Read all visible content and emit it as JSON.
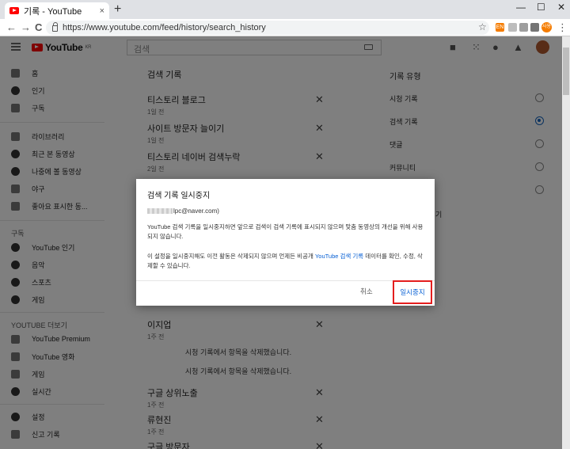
{
  "browser": {
    "tab_title": "기록 - YouTube",
    "tab_close": "×",
    "new_tab": "+",
    "url": "https://www.youtube.com/feed/history/search_history",
    "window_controls": [
      "—",
      "☐",
      "✕"
    ],
    "nav": {
      "back": "←",
      "forward": "→",
      "reload": "C"
    },
    "extensions": [
      {
        "label": "EN",
        "color": "#f57c00"
      },
      {
        "label": "",
        "color": "#bdbdbd"
      },
      {
        "label": "",
        "color": "#9e9e9e"
      },
      {
        "label": "",
        "color": "#757575"
      }
    ],
    "profile_label": "사용"
  },
  "header": {
    "logo_text": "YouTube",
    "logo_region": "KR",
    "search_placeholder": "검색",
    "icons": [
      "video-create-icon",
      "apps-icon",
      "messages-icon",
      "notifications-icon"
    ]
  },
  "sidebar": {
    "items_top": [
      {
        "label": "홈",
        "icon": "home-icon"
      },
      {
        "label": "인기",
        "icon": "trending-icon"
      },
      {
        "label": "구독",
        "icon": "subscriptions-icon"
      }
    ],
    "items_library": [
      {
        "label": "라이브러리",
        "icon": "library-icon"
      },
      {
        "label": "최근 본 동영상",
        "icon": "history-icon"
      },
      {
        "label": "나중에 볼 동영상",
        "icon": "watch-later-icon"
      },
      {
        "label": "야구",
        "icon": "playlist-icon"
      },
      {
        "label": "좋아요 표시한 동...",
        "icon": "like-icon"
      }
    ],
    "section_subscriptions": "구독",
    "items_subscriptions": [
      {
        "label": "YouTube 인기",
        "icon": "channel-icon"
      },
      {
        "label": "음악",
        "icon": "music-icon"
      },
      {
        "label": "스포츠",
        "icon": "sports-icon"
      },
      {
        "label": "게임",
        "icon": "gaming-icon"
      }
    ],
    "section_more": "YOUTUBE 더보기",
    "items_more": [
      {
        "label": "YouTube Premium",
        "icon": "premium-icon"
      },
      {
        "label": "YouTube 영화",
        "icon": "movies-icon"
      },
      {
        "label": "게임",
        "icon": "gaming-icon"
      },
      {
        "label": "실시간",
        "icon": "live-icon"
      }
    ],
    "items_bottom": [
      {
        "label": "설정",
        "icon": "settings-icon"
      },
      {
        "label": "신고 기록",
        "icon": "flag-icon"
      }
    ]
  },
  "main": {
    "title": "검색 기록",
    "history_top": [
      {
        "query": "티스토리 블로그",
        "when": "1일 전"
      },
      {
        "query": "사이트 방문자 늘이기",
        "when": "1일 전"
      },
      {
        "query": "티스토리 네이버 검색누락",
        "when": "2일 전"
      }
    ],
    "history_mid": {
      "query": "이지업",
      "when": "1주 전"
    },
    "removed_notice": "시청 기록에서 항목을 삭제했습니다.",
    "history_bottom": [
      {
        "query": "구글 상위노출",
        "when": "1주 전"
      },
      {
        "query": "류현진",
        "when": "1주 전"
      },
      {
        "query": "구글 방문자",
        "when": ""
      }
    ],
    "remove_glyph": "✕"
  },
  "right_panel": {
    "title": "기록 유형",
    "options": [
      {
        "label": "시청 기록",
        "selected": false
      },
      {
        "label": "검색 기록",
        "selected": true
      },
      {
        "label": "댓글",
        "selected": false
      },
      {
        "label": "커뮤니티",
        "selected": false
      },
      {
        "label": "",
        "selected": false
      }
    ],
    "partial_text": "기"
  },
  "dialog": {
    "title": "검색 기록 일시중지",
    "email_visible": "lpc@naver.com)",
    "paragraph1": "YouTube 검색 기록을 일시중지하면 앞으로 검색이 검색 기록에 표시되지 않으며 맞춤 동영상의 개선을 위해 사용되지 않습니다.",
    "paragraph2_before": "이 설정을 일시중지해도 이전 활동은 삭제되지 않으며 언제든 비공개 ",
    "paragraph2_link": "YouTube 검색 기록",
    "paragraph2_after": " 데이터를 확인, 수정, 삭제할 수 있습니다.",
    "cancel_label": "취소",
    "confirm_label": "일시중지"
  }
}
